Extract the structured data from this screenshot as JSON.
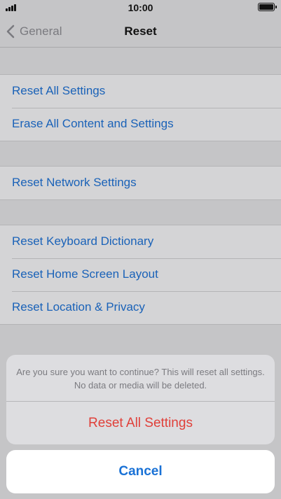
{
  "status_bar": {
    "time": "10:00"
  },
  "nav": {
    "back_label": "General",
    "title": "Reset"
  },
  "groups": [
    {
      "items": [
        {
          "label": "Reset All Settings"
        },
        {
          "label": "Erase All Content and Settings"
        }
      ]
    },
    {
      "items": [
        {
          "label": "Reset Network Settings"
        }
      ]
    },
    {
      "items": [
        {
          "label": "Reset Keyboard Dictionary"
        },
        {
          "label": "Reset Home Screen Layout"
        },
        {
          "label": "Reset Location & Privacy"
        }
      ]
    }
  ],
  "action_sheet": {
    "message": "Are you sure you want to continue? This will reset all settings. No data or media will be deleted.",
    "confirm_label": "Reset All Settings",
    "cancel_label": "Cancel"
  },
  "colors": {
    "link": "#1a62b8",
    "destructive": "#e0403a",
    "cancel": "#1a72d6"
  }
}
